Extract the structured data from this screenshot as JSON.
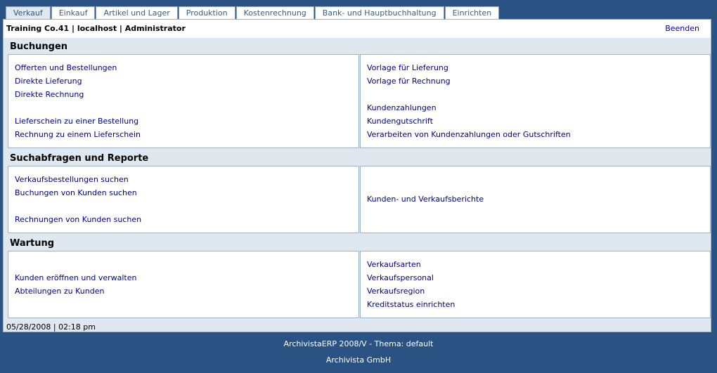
{
  "tabs": [
    "Verkauf",
    "Einkauf",
    "Artikel und Lager",
    "Produktion",
    "Kostenrechnung",
    "Bank- und Hauptbuchhaltung",
    "Einrichten"
  ],
  "header": {
    "company": "Training Co.41 | localhost | Administrator",
    "logout": "Beenden"
  },
  "sections": {
    "buchungen": {
      "title": "Buchungen",
      "left": [
        "Offerten und Bestellungen",
        "Direkte Lieferung",
        "Direkte Rechnung",
        "Lieferschein zu einer Bestellung",
        "Rechnung zu einem Lieferschein"
      ],
      "right": [
        "Vorlage für Lieferung",
        "Vorlage für Rechnung",
        "Kundenzahlungen",
        "Kundengutschrift",
        "Verarbeiten von Kundenzahlungen oder Gutschriften"
      ]
    },
    "suche": {
      "title": "Suchabfragen und Reporte",
      "left": [
        "Verkaufsbestellungen suchen",
        "Buchungen von Kunden suchen",
        "Rechnungen von Kunden suchen"
      ],
      "right": [
        "Kunden- und Verkaufsberichte"
      ]
    },
    "wartung": {
      "title": "Wartung",
      "left": [
        "Kunden eröffnen und verwalten",
        "Abteilungen zu Kunden"
      ],
      "right": [
        "Verkaufsarten",
        "Verkaufspersonal",
        "Verkaufsregion",
        "Kreditstatus einrichten"
      ]
    }
  },
  "status": {
    "datetime": "05/28/2008 | 02:18 pm"
  },
  "footer": {
    "line1": "ArchivistaERP 2008/V - Thema: default",
    "line2": "Archivista GmbH"
  }
}
